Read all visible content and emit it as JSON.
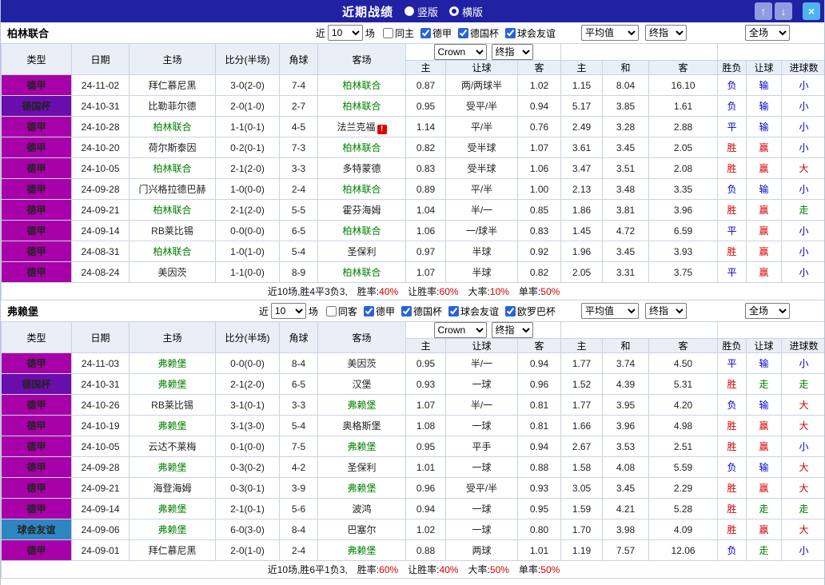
{
  "topbar": {
    "title": "近期战绩",
    "layout_options": [
      {
        "label": "竖版",
        "selected": false
      },
      {
        "label": "横版",
        "selected": true
      }
    ],
    "up_icon": "↑",
    "down_icon": "↓",
    "close_icon": "×"
  },
  "controls": {
    "near_label": "近",
    "games_count": "10",
    "games_label": "场",
    "bookmaker_select": "Crown",
    "final_select": "终指",
    "average_select": "平均值",
    "scope_select": "全场"
  },
  "columns": [
    "类型",
    "日期",
    "主场",
    "比分(半场)",
    "角球",
    "客场",
    "主",
    "让球",
    "客",
    "主",
    "和",
    "客",
    "胜负",
    "让球",
    "进球数"
  ],
  "type_colors": {
    "德甲": "#a800a8",
    "德国杯": "#6a0dad",
    "球会友谊": "#2e86c1"
  },
  "result_colors": {
    "胜": "#d40000",
    "平": "#0000cc",
    "负": "#0000cc",
    "赢": "#d40000",
    "输": "#0000cc",
    "走": "#008000",
    "大": "#d40000",
    "小": "#0000cc"
  },
  "accent": {
    "score": "#e60000",
    "focus_team": "#008000",
    "summary_value": "#d40000",
    "topbar_bg": "#2121a3"
  },
  "sections": [
    {
      "team": "柏林联合",
      "filters": [
        {
          "label": "同主",
          "checked": false
        },
        {
          "label": "德甲",
          "checked": true
        },
        {
          "label": "德国杯",
          "checked": true
        },
        {
          "label": "球会友谊",
          "checked": true
        }
      ],
      "rows": [
        {
          "type": "德甲",
          "date": "24-11-02",
          "home": "拜仁慕尼黑",
          "score": "3-0(2-0)",
          "corners": "7-4",
          "away": "柏林联合",
          "ah_home": "0.87",
          "handicap": "两/两球半",
          "ah_away": "1.02",
          "odds_home": "1.15",
          "odds_draw": "8.04",
          "odds_away": "16.10",
          "result": "负",
          "ah_result": "输",
          "goals": "小"
        },
        {
          "type": "德国杯",
          "date": "24-10-31",
          "home": "比勒菲尔德",
          "score": "2-0(1-0)",
          "corners": "2-7",
          "away": "柏林联合",
          "ah_home": "0.95",
          "handicap": "受平/半",
          "ah_away": "0.94",
          "odds_home": "5.17",
          "odds_draw": "3.85",
          "odds_away": "1.61",
          "result": "负",
          "ah_result": "输",
          "goals": "小"
        },
        {
          "type": "德甲",
          "date": "24-10-28",
          "home": "柏林联合",
          "score": "1-1(0-1)",
          "corners": "4-5",
          "away": "法兰克福",
          "away_alert": true,
          "ah_home": "1.14",
          "handicap": "平/半",
          "ah_away": "0.76",
          "odds_home": "2.49",
          "odds_draw": "3.28",
          "odds_away": "2.88",
          "result": "平",
          "ah_result": "输",
          "goals": "小"
        },
        {
          "type": "德甲",
          "date": "24-10-20",
          "home": "荷尔斯泰因",
          "score": "0-2(0-1)",
          "corners": "7-3",
          "away": "柏林联合",
          "ah_home": "0.82",
          "handicap": "受半球",
          "ah_away": "1.07",
          "odds_home": "3.61",
          "odds_draw": "3.45",
          "odds_away": "2.05",
          "result": "胜",
          "ah_result": "赢",
          "goals": "小"
        },
        {
          "type": "德甲",
          "date": "24-10-05",
          "home": "柏林联合",
          "score": "2-1(2-0)",
          "corners": "3-3",
          "away": "多特蒙德",
          "ah_home": "0.83",
          "handicap": "受半球",
          "ah_away": "1.06",
          "odds_home": "3.47",
          "odds_draw": "3.51",
          "odds_away": "2.08",
          "result": "胜",
          "ah_result": "赢",
          "goals": "大"
        },
        {
          "type": "德甲",
          "date": "24-09-28",
          "home": "门兴格拉德巴赫",
          "score": "1-0(0-0)",
          "corners": "2-4",
          "away": "柏林联合",
          "ah_home": "0.89",
          "handicap": "平/半",
          "ah_away": "1.00",
          "odds_home": "2.13",
          "odds_draw": "3.48",
          "odds_away": "3.35",
          "result": "负",
          "ah_result": "输",
          "goals": "小"
        },
        {
          "type": "德甲",
          "date": "24-09-21",
          "home": "柏林联合",
          "score": "2-1(2-0)",
          "corners": "5-5",
          "away": "霍芬海姆",
          "ah_home": "1.04",
          "handicap": "半/一",
          "ah_away": "0.85",
          "odds_home": "1.86",
          "odds_draw": "3.81",
          "odds_away": "3.96",
          "result": "胜",
          "ah_result": "赢",
          "goals": "走"
        },
        {
          "type": "德甲",
          "date": "24-09-14",
          "home": "RB莱比锡",
          "score": "0-0(0-0)",
          "corners": "6-5",
          "away": "柏林联合",
          "ah_home": "1.06",
          "handicap": "一/球半",
          "ah_away": "0.83",
          "odds_home": "1.45",
          "odds_draw": "4.72",
          "odds_away": "6.59",
          "result": "平",
          "ah_result": "赢",
          "goals": "小"
        },
        {
          "type": "德甲",
          "date": "24-08-31",
          "home": "柏林联合",
          "score": "1-0(1-0)",
          "corners": "5-4",
          "away": "圣保利",
          "ah_home": "0.97",
          "handicap": "半球",
          "ah_away": "0.92",
          "odds_home": "1.96",
          "odds_draw": "3.45",
          "odds_away": "3.93",
          "result": "胜",
          "ah_result": "赢",
          "goals": "小"
        },
        {
          "type": "德甲",
          "date": "24-08-24",
          "home": "美因茨",
          "score": "1-1(0-0)",
          "corners": "8-9",
          "away": "柏林联合",
          "ah_home": "1.07",
          "handicap": "半球",
          "ah_away": "0.82",
          "odds_home": "2.05",
          "odds_draw": "3.31",
          "odds_away": "3.75",
          "result": "平",
          "ah_result": "赢",
          "goals": "小"
        }
      ],
      "summary_prefix": "近10场,胜4平3负3,",
      "summary_stats": [
        {
          "label": "胜率:",
          "value": "40%"
        },
        {
          "label": "让胜率:",
          "value": "60%"
        },
        {
          "label": "大率:",
          "value": "10%"
        },
        {
          "label": "单率:",
          "value": "50%"
        }
      ]
    },
    {
      "team": "弗赖堡",
      "filters": [
        {
          "label": "同客",
          "checked": false
        },
        {
          "label": "德甲",
          "checked": true
        },
        {
          "label": "德国杯",
          "checked": true
        },
        {
          "label": "球会友谊",
          "checked": true
        },
        {
          "label": "欧罗巴杯",
          "checked": true
        }
      ],
      "rows": [
        {
          "type": "德甲",
          "date": "24-11-03",
          "home": "弗赖堡",
          "score": "0-0(0-0)",
          "corners": "8-4",
          "away": "美因茨",
          "ah_home": "0.95",
          "handicap": "半/一",
          "ah_away": "0.94",
          "odds_home": "1.77",
          "odds_draw": "3.74",
          "odds_away": "4.50",
          "result": "平",
          "ah_result": "输",
          "goals": "小"
        },
        {
          "type": "德国杯",
          "date": "24-10-31",
          "home": "弗赖堡",
          "score": "2-1(2-0)",
          "corners": "6-5",
          "away": "汉堡",
          "ah_home": "0.93",
          "handicap": "一球",
          "ah_away": "0.96",
          "odds_home": "1.52",
          "odds_draw": "4.39",
          "odds_away": "5.31",
          "result": "胜",
          "ah_result": "走",
          "goals": "走"
        },
        {
          "type": "德甲",
          "date": "24-10-26",
          "home": "RB莱比锡",
          "score": "3-1(0-1)",
          "corners": "3-3",
          "away": "弗赖堡",
          "ah_home": "1.07",
          "handicap": "半/一",
          "ah_away": "0.81",
          "odds_home": "1.77",
          "odds_draw": "3.95",
          "odds_away": "4.20",
          "result": "负",
          "ah_result": "输",
          "goals": "大"
        },
        {
          "type": "德甲",
          "date": "24-10-19",
          "home": "弗赖堡",
          "score": "3-1(3-0)",
          "corners": "5-4",
          "away": "奥格斯堡",
          "ah_home": "1.08",
          "handicap": "一球",
          "ah_away": "0.81",
          "odds_home": "1.66",
          "odds_draw": "3.96",
          "odds_away": "4.98",
          "result": "胜",
          "ah_result": "赢",
          "goals": "大"
        },
        {
          "type": "德甲",
          "date": "24-10-05",
          "home": "云达不莱梅",
          "score": "0-1(0-0)",
          "corners": "7-5",
          "away": "弗赖堡",
          "ah_home": "0.95",
          "handicap": "平手",
          "ah_away": "0.94",
          "odds_home": "2.67",
          "odds_draw": "3.53",
          "odds_away": "2.51",
          "result": "胜",
          "ah_result": "赢",
          "goals": "小"
        },
        {
          "type": "德甲",
          "date": "24-09-28",
          "home": "弗赖堡",
          "score": "0-3(0-2)",
          "corners": "4-2",
          "away": "圣保利",
          "ah_home": "1.01",
          "handicap": "一球",
          "ah_away": "0.88",
          "odds_home": "1.58",
          "odds_draw": "4.08",
          "odds_away": "5.59",
          "result": "负",
          "ah_result": "输",
          "goals": "大"
        },
        {
          "type": "德甲",
          "date": "24-09-21",
          "home": "海登海姆",
          "score": "0-3(0-1)",
          "corners": "3-9",
          "away": "弗赖堡",
          "ah_home": "0.96",
          "handicap": "受平/半",
          "ah_away": "0.93",
          "odds_home": "3.05",
          "odds_draw": "3.45",
          "odds_away": "2.29",
          "result": "胜",
          "ah_result": "赢",
          "goals": "大"
        },
        {
          "type": "德甲",
          "date": "24-09-14",
          "home": "弗赖堡",
          "score": "2-1(0-1)",
          "corners": "5-6",
          "away": "波鸿",
          "ah_home": "0.94",
          "handicap": "一球",
          "ah_away": "0.95",
          "odds_home": "1.59",
          "odds_draw": "4.21",
          "odds_away": "5.28",
          "result": "胜",
          "ah_result": "走",
          "goals": "走"
        },
        {
          "type": "球会友谊",
          "date": "24-09-06",
          "home": "弗赖堡",
          "score": "6-0(3-0)",
          "corners": "8-4",
          "away": "巴塞尔",
          "ah_home": "1.02",
          "handicap": "一球",
          "ah_away": "0.80",
          "odds_home": "1.70",
          "odds_draw": "3.98",
          "odds_away": "4.09",
          "result": "胜",
          "ah_result": "赢",
          "goals": "大"
        },
        {
          "type": "德甲",
          "date": "24-09-01",
          "home": "拜仁慕尼黑",
          "score": "2-0(1-0)",
          "corners": "2-4",
          "away": "弗赖堡",
          "ah_home": "0.88",
          "handicap": "两球",
          "ah_away": "1.01",
          "odds_home": "1.19",
          "odds_draw": "7.57",
          "odds_away": "12.06",
          "result": "负",
          "ah_result": "走",
          "goals": "小"
        }
      ],
      "summary_prefix": "近10场,胜6平1负3,",
      "summary_stats": [
        {
          "label": "胜率:",
          "value": "60%"
        },
        {
          "label": "让胜率:",
          "value": "40%"
        },
        {
          "label": "大率:",
          "value": "50%"
        },
        {
          "label": "单率:",
          "value": "50%"
        }
      ]
    }
  ]
}
